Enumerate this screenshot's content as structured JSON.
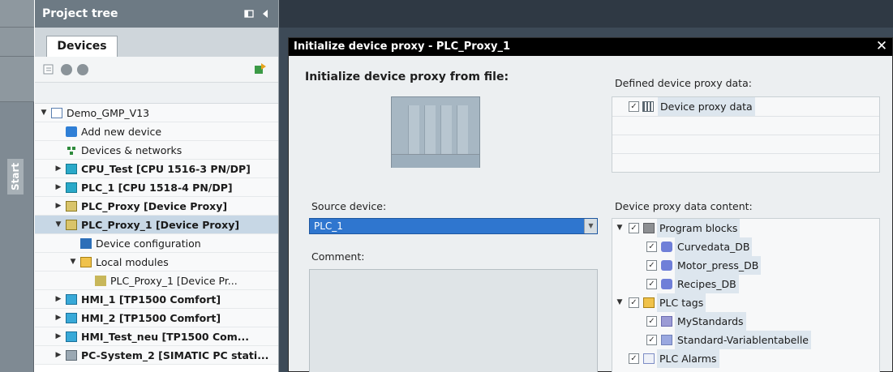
{
  "start_strip": {
    "label": "Start"
  },
  "project_tree": {
    "title": "Project tree",
    "tab": "Devices",
    "items": [
      {
        "label": "Demo_GMP_V13",
        "indent": 0,
        "arrow": "▼",
        "icon": "project-icon"
      },
      {
        "label": "Add new device",
        "indent": 1,
        "arrow": "",
        "icon": "add-device-icon"
      },
      {
        "label": "Devices & networks",
        "indent": 1,
        "arrow": "",
        "icon": "network-icon"
      },
      {
        "label": "CPU_Test [CPU 1516-3 PN/DP]",
        "indent": 1,
        "arrow": "▶",
        "icon": "cpu-icon",
        "bold": true
      },
      {
        "label": "PLC_1 [CPU 1518-4 PN/DP]",
        "indent": 1,
        "arrow": "▶",
        "icon": "cpu-icon",
        "bold": true
      },
      {
        "label": "PLC_Proxy [Device Proxy]",
        "indent": 1,
        "arrow": "▶",
        "icon": "device-proxy-icon",
        "bold": true
      },
      {
        "label": "PLC_Proxy_1 [Device Proxy]",
        "indent": 1,
        "arrow": "▼",
        "icon": "device-proxy-icon",
        "bold": true,
        "selected": true
      },
      {
        "label": "Device configuration",
        "indent": 2,
        "arrow": "",
        "icon": "device-config-icon"
      },
      {
        "label": "Local modules",
        "indent": 2,
        "arrow": "▼",
        "icon": "module-folder-icon"
      },
      {
        "label": "PLC_Proxy_1 [Device Pr...",
        "indent": 3,
        "arrow": "",
        "icon": "proxy-module-icon"
      },
      {
        "label": "HMI_1 [TP1500 Comfort]",
        "indent": 1,
        "arrow": "▶",
        "icon": "hmi-icon",
        "bold": true
      },
      {
        "label": "HMI_2 [TP1500 Comfort]",
        "indent": 1,
        "arrow": "▶",
        "icon": "hmi-icon",
        "bold": true
      },
      {
        "label": "HMI_Test_neu [TP1500 Com...",
        "indent": 1,
        "arrow": "▶",
        "icon": "hmi-icon",
        "bold": true
      },
      {
        "label": "PC-System_2 [SIMATIC PC stati...",
        "indent": 1,
        "arrow": "▶",
        "icon": "pc-station-icon",
        "bold": true
      }
    ]
  },
  "dialog": {
    "title": "Initialize device proxy - PLC_Proxy_1",
    "close_glyph": "✕",
    "init_heading": "Initialize device proxy from file:",
    "defined_label": "Defined device proxy data:",
    "defined_item": "Device proxy data",
    "source_label": "Source device:",
    "source_value": "PLC_1",
    "comment_label": "Comment:",
    "content_label": "Device proxy data content:",
    "content_items": [
      {
        "label": "Program blocks",
        "indent": 0,
        "arrow": "▼",
        "icon": "program-blocks-icon",
        "highlight": true
      },
      {
        "label": "Curvedata_DB",
        "indent": 1,
        "arrow": "",
        "icon": "data-block-icon",
        "highlight": true
      },
      {
        "label": "Motor_press_DB",
        "indent": 1,
        "arrow": "",
        "icon": "data-block-icon",
        "highlight": true
      },
      {
        "label": "Recipes_DB",
        "indent": 1,
        "arrow": "",
        "icon": "data-block-icon",
        "highlight": true
      },
      {
        "label": "PLC tags",
        "indent": 0,
        "arrow": "▼",
        "icon": "tags-folder-icon",
        "highlight": true
      },
      {
        "label": "MyStandards",
        "indent": 1,
        "arrow": "",
        "icon": "tag-table-icon",
        "highlight": true
      },
      {
        "label": "Standard-Variablentabelle",
        "indent": 1,
        "arrow": "",
        "icon": "default-tag-table-icon",
        "highlight": true
      },
      {
        "label": "PLC Alarms",
        "indent": 0,
        "arrow": "",
        "icon": "alarms-icon",
        "highlight": true
      }
    ],
    "checkbox_glyph": "✓"
  }
}
